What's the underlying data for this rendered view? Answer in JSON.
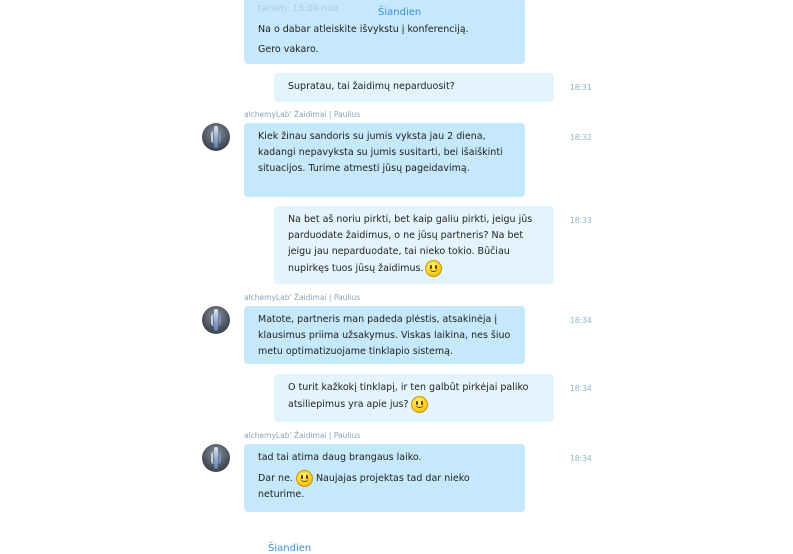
{
  "chat": {
    "date_label": "Šiandien",
    "date_label_bottom": "Šiandien",
    "top_faded": "tarsim: 15:00 nuo",
    "msg0": {
      "lines": [
        "Na o dabar atleiskite išvykstu į konferenciją.",
        "Gero vakaro."
      ]
    },
    "msg1": {
      "text": "Supratau, tai žaidimų neparduosit?",
      "time": "18:31"
    },
    "sender1": "alchemyLab' Žaidimai | Paulius",
    "msg2": {
      "text": "Kiek žinau sandoris su jumis vyksta jau 2 diena, kadangi nepavyksta su jumis susitarti, bei išaiškinti situacijos. Turime atmesti jūsų pageidavimą.",
      "time": "18:32"
    },
    "msg3": {
      "text": "Na bet aš noriu pirkti, bet kaip galiu pirkti, jeigu jūs parduodate žaidimus, o ne jūsų partneris? Na bet jeigu jau neparduodate, tai nieko tokio. Būčiau nupirkęs tuos jūsų žaidimus.",
      "time": "18:33",
      "emoji": "smiley-icon"
    },
    "sender2": "alchemyLab' Žaidimai | Paulius",
    "msg4": {
      "text": "Matote, partneris man padeda plėstis, atsakinėja į klausimus priima užsakymus. Viskas laikina, nes šiuo metu optimatizuojame tinklapio sistemą.",
      "time": "18:34"
    },
    "msg5": {
      "text": "O turit kažkokį tinklapį, ir ten galbūt pirkėjai paliko atsiliepimus yra apie jus?",
      "time": "18:34",
      "emoji": "smiley-icon"
    },
    "sender3": "alchemyLab' Žaidimai | Paulius",
    "msg6": {
      "line1": "tad tai atima daug brangaus laiko.",
      "line2_pre": "Dar ne.",
      "line2_post": "Naujajas projektas tad dar nieko neturime.",
      "time": "18:34",
      "emoji": "smiley-icon"
    }
  }
}
